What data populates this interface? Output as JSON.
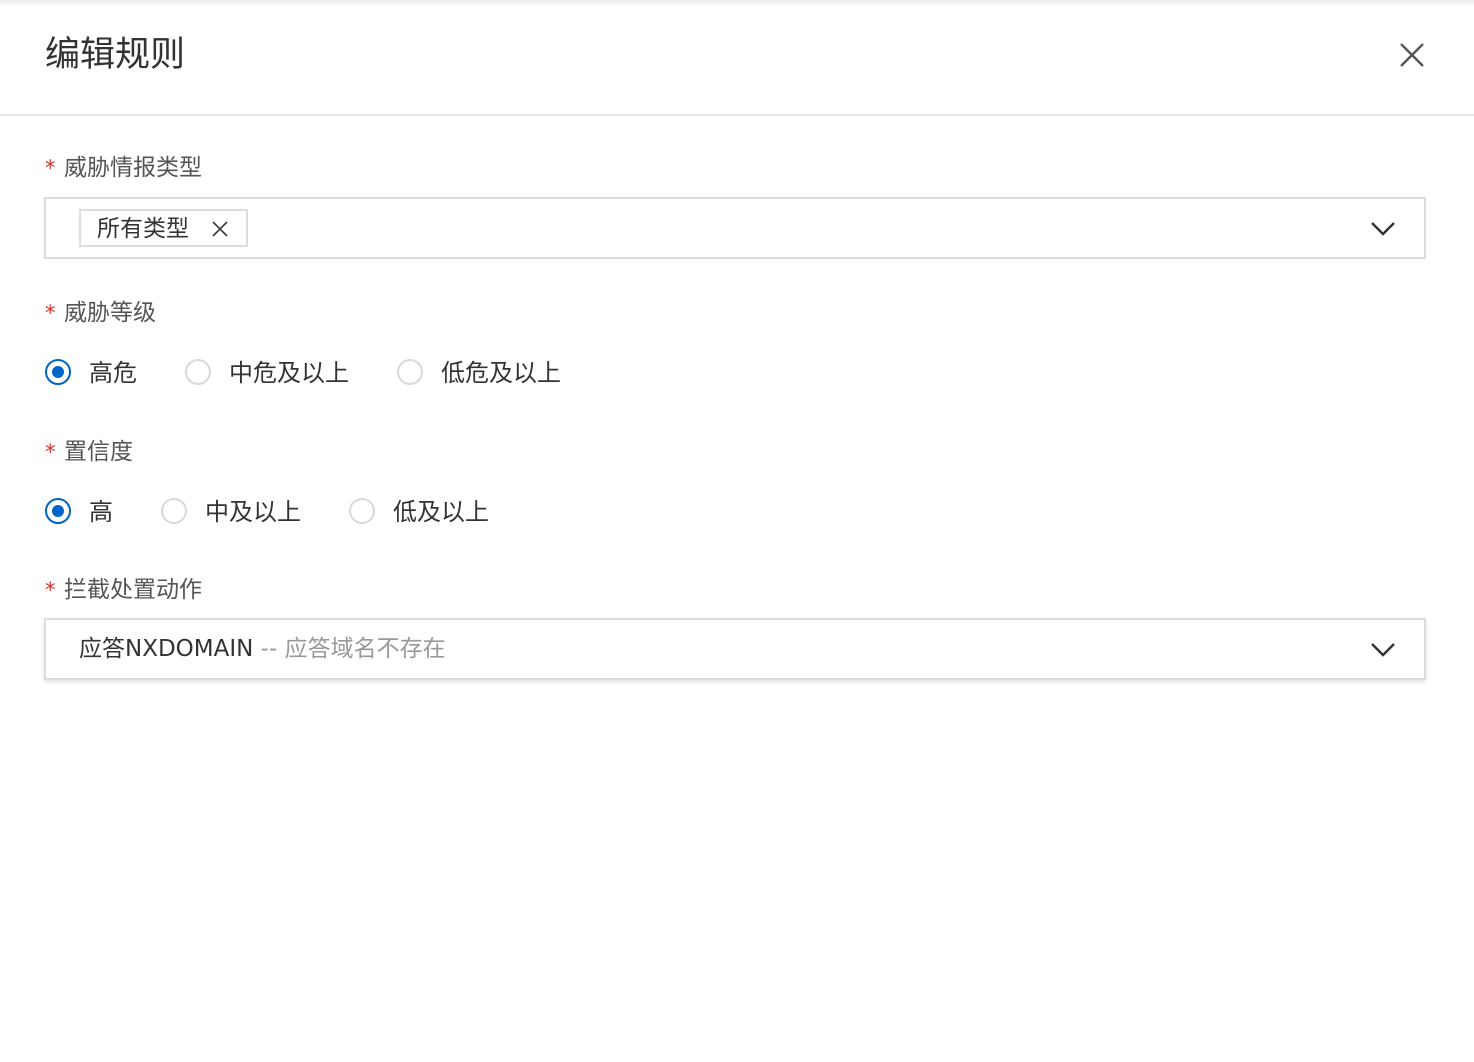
{
  "dialog": {
    "title": "编辑规则"
  },
  "fields": {
    "threat_type": {
      "label": "威胁情报类型",
      "required_mark": "*",
      "tags": [
        "所有类型"
      ]
    },
    "threat_level": {
      "label": "威胁等级",
      "required_mark": "*",
      "options": [
        "高危",
        "中危及以上",
        "低危及以上"
      ],
      "selected": "高危"
    },
    "confidence": {
      "label": "置信度",
      "required_mark": "*",
      "options": [
        "高",
        "中及以上",
        "低及以上"
      ],
      "selected": "高"
    },
    "block_action": {
      "label": "拦截处置动作",
      "required_mark": "*",
      "value": "应答NXDOMAIN",
      "value_desc": " -- 应答域名不存在"
    }
  },
  "colors": {
    "accent": "#0064c8",
    "required": "#d93026",
    "border": "#dddddd",
    "muted_text": "#999999"
  }
}
